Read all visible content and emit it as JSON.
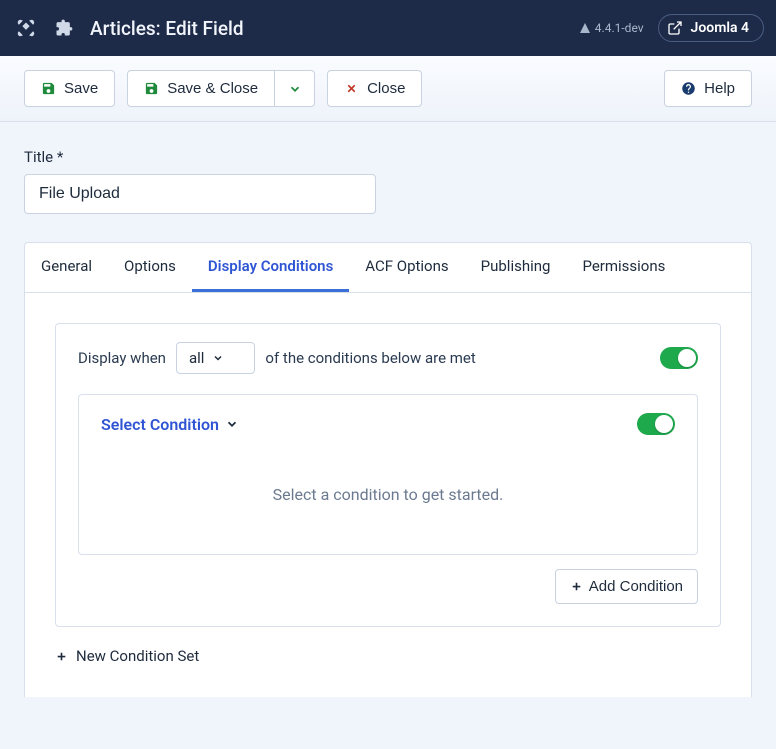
{
  "header": {
    "page_title": "Articles: Edit Field",
    "version": "4.4.1-dev",
    "badge_label": "Joomla 4"
  },
  "toolbar": {
    "save_label": "Save",
    "save_close_label": "Save & Close",
    "close_label": "Close",
    "help_label": "Help"
  },
  "title_field": {
    "label": "Title *",
    "value": "File Upload"
  },
  "tabs": [
    {
      "label": "General"
    },
    {
      "label": "Options"
    },
    {
      "label": "Display Conditions"
    },
    {
      "label": "ACF Options"
    },
    {
      "label": "Publishing"
    },
    {
      "label": "Permissions"
    }
  ],
  "conditions": {
    "prefix": "Display when",
    "selector_value": "all",
    "suffix": "of the conditions below are met",
    "select_condition_label": "Select Condition",
    "placeholder": "Select a condition to get started.",
    "add_condition_label": "Add Condition",
    "new_set_label": "New Condition Set"
  }
}
